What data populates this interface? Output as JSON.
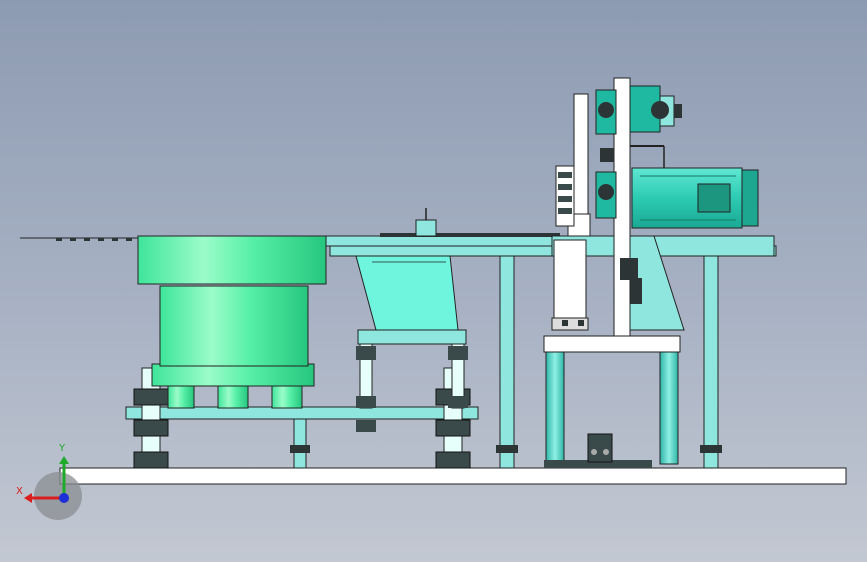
{
  "triad": {
    "x_label": "X",
    "y_label": "Y",
    "x_color": "#d81e1e",
    "y_color": "#1faa2a",
    "z_color": "#1d2fd8"
  },
  "colors": {
    "bowl": "#4ff2a6",
    "frame": "#8fe6de",
    "motor": "#2fcfb6",
    "dark": "#2d3436",
    "base": "#ffffff"
  }
}
